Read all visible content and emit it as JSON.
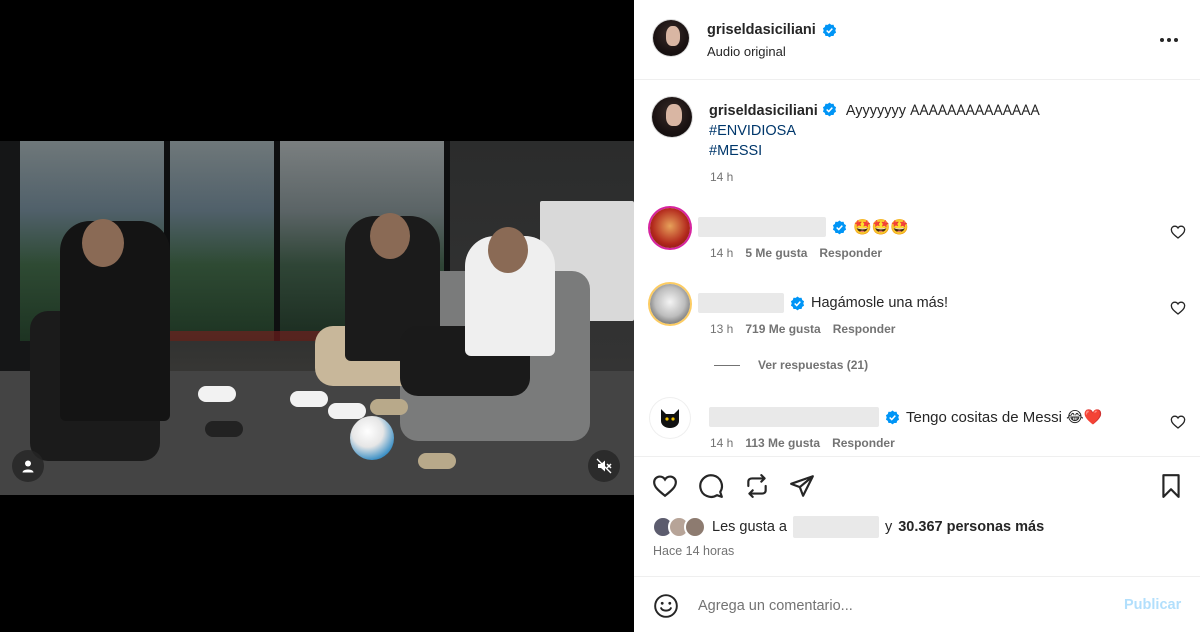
{
  "post": {
    "username": "griseldasiciliani",
    "audio_label": "Audio original",
    "caption_text": "Ayyyyyyy 𐊠𐊠𐊠𐊠𐊠𐊠𐊠𐊠𐊠𐊠𐊠𐊠𐊠𐊠",
    "hashtags": [
      "#ENVIDIOSA",
      "#MESSI"
    ],
    "caption_time": "14 h"
  },
  "comments": [
    {
      "text": "🤩🤩🤩",
      "time": "14 h",
      "likes": "5 Me gusta",
      "reply": "Responder"
    },
    {
      "text": "Hagámosle una más!",
      "time": "13 h",
      "likes": "719 Me gusta",
      "reply": "Responder"
    },
    {
      "text": "Tengo cositas de Messi 😂❤️",
      "time": "14 h",
      "likes": "113 Me gusta",
      "reply": "Responder"
    }
  ],
  "view_replies": "Ver respuestas (21)",
  "likes": {
    "prefix": "Les gusta a",
    "connector": "y",
    "count_text": "30.367 personas más"
  },
  "posted_ago": "Hace 14 horas",
  "add_comment": {
    "placeholder": "Agrega un comentario...",
    "publish_label": "Publicar"
  },
  "icons": {
    "verified": "verified-badge-icon",
    "more": "more-options-icon",
    "like": "heart-icon",
    "comment": "comment-icon",
    "share_repost": "repost-icon",
    "send": "paper-plane-icon",
    "save": "bookmark-icon",
    "emoji": "emoji-icon",
    "mute": "muted-speaker-icon",
    "tagged_user": "user-icon"
  },
  "colors": {
    "verified_blue": "#0095f6",
    "hashtag": "#00376b",
    "publish_disabled": "#b2dffc",
    "heart_red": "#e0245e"
  }
}
